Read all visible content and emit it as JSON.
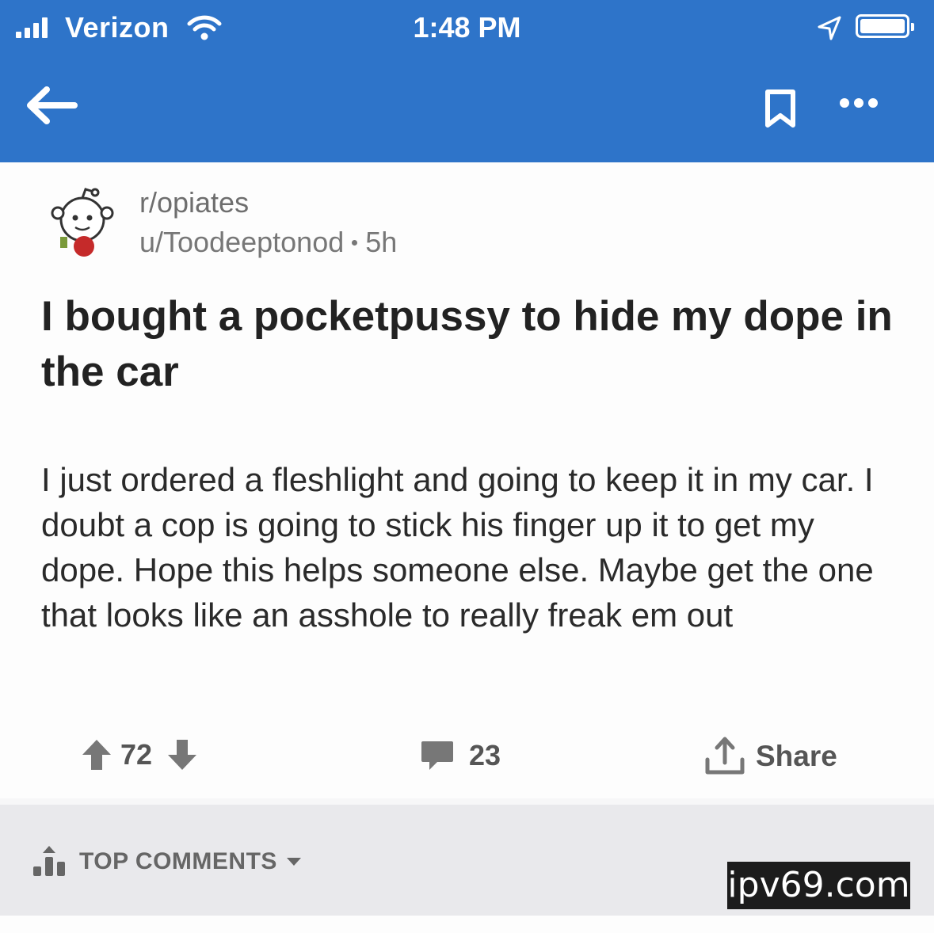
{
  "status_bar": {
    "carrier": "Verizon",
    "time": "1:48 PM"
  },
  "toolbar": {
    "back_icon": "arrow-left-icon",
    "bookmark_icon": "bookmark-icon",
    "more_icon": "more-horizontal-icon"
  },
  "post": {
    "subreddit": "r/opiates",
    "author": "u/Toodeeptonod",
    "age": "5h",
    "title": "I bought a pocketpussy to hide my dope in the car",
    "body": "I just ordered a fleshlight and going to keep it in my car. I doubt a cop is going to stick his finger up it to get my dope. Hope this helps someone else. Maybe get the one that looks like an asshole to really freak em out",
    "score": "72",
    "comment_count": "23",
    "share_label": "Share"
  },
  "comments_section": {
    "sort_label": "TOP COMMENTS"
  },
  "watermark": "ipv69.com",
  "colors": {
    "header": "#2e74c9",
    "text": "#222222",
    "muted": "#777777",
    "sort_bar": "#e9e9ec"
  }
}
